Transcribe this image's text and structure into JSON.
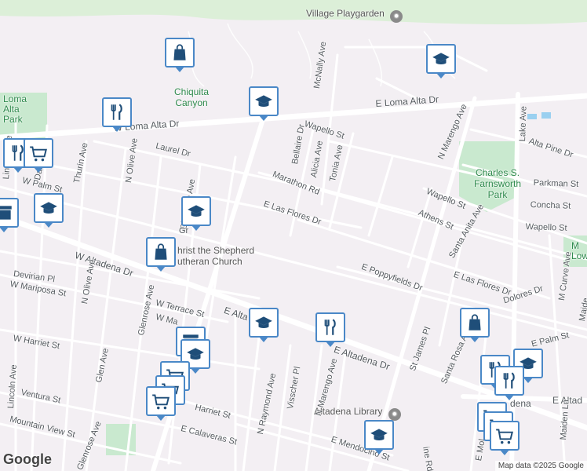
{
  "map": {
    "attribution": "Map data ©2025 Google",
    "logo": "Google",
    "colors": {
      "background": "#f3eff3",
      "park": "#c9e9cf",
      "road": "#ffffff",
      "marker_border": "#4a88c7",
      "marker_icon": "#1f4e79"
    }
  },
  "streets": [
    {
      "id": "e-loma-alta-dr",
      "label": "E Loma Alta Dr"
    },
    {
      "id": "w-loma-alta-dr",
      "label": "W Loma Alta Dr"
    },
    {
      "id": "mcnally-ave",
      "label": "McNally Ave"
    },
    {
      "id": "bellaire-dr",
      "label": "Bellaire Dr"
    },
    {
      "id": "alicia-ave",
      "label": "Alicia Ave"
    },
    {
      "id": "tonia-ave",
      "label": "Tonia Ave"
    },
    {
      "id": "wapello-st-n",
      "label": "Wapello St"
    },
    {
      "id": "n-marengo-ave-n",
      "label": "N Marengo Ave"
    },
    {
      "id": "lake-ave",
      "label": "Lake Ave"
    },
    {
      "id": "alta-pine-dr",
      "label": "Alta Pine Dr"
    },
    {
      "id": "laurel-dr",
      "label": "Laurel Dr"
    },
    {
      "id": "dabney-st",
      "label": "Dabney St"
    },
    {
      "id": "thurin-ave",
      "label": "Thurin Ave"
    },
    {
      "id": "n-olive-ave-n",
      "label": "N Olive Ave"
    },
    {
      "id": "marathon-rd",
      "label": "Marathon Rd"
    },
    {
      "id": "w-palm-st",
      "label": "W Palm St"
    },
    {
      "id": "lincoln-ave-n",
      "label": "Lincoln Ave"
    },
    {
      "id": "parkman-st",
      "label": "Parkman St"
    },
    {
      "id": "wapello-st-e",
      "label": "Wapello St"
    },
    {
      "id": "concha-st",
      "label": "Concha St"
    },
    {
      "id": "athens-st",
      "label": "Athens St"
    },
    {
      "id": "wapello-st-se",
      "label": "Wapello St"
    },
    {
      "id": "e-las-flores-dr",
      "label": "E Las Flores Dr"
    },
    {
      "id": "santa-anita-ave",
      "label": "Santa Anita Ave"
    },
    {
      "id": "glenrose-ave-n",
      "label": "Glenrose Ave"
    },
    {
      "id": "w-altadena-dr",
      "label": "W Altadena Dr"
    },
    {
      "id": "devirian-pl",
      "label": "Devirian Pl"
    },
    {
      "id": "n-olive-ave-s",
      "label": "N Olive Ave"
    },
    {
      "id": "w-mariposa-st",
      "label": "W Mariposa St"
    },
    {
      "id": "w-terrace-st",
      "label": "W Terrace St"
    },
    {
      "id": "glenrose-ave-s",
      "label": "Glenrose Ave"
    },
    {
      "id": "w-ma",
      "label": "W Ma"
    },
    {
      "id": "e-poppyfields-dr",
      "label": "E Poppyfields Dr"
    },
    {
      "id": "e-las-flores-dr-e",
      "label": "E Las Flores Dr"
    },
    {
      "id": "m-curve-ave",
      "label": "M Curve Ave"
    },
    {
      "id": "dolores-dr",
      "label": "Dolores Dr"
    },
    {
      "id": "e-altadena-dr-w",
      "label": "E Alta"
    },
    {
      "id": "e-altadena-dr",
      "label": "E Altadena Dr"
    },
    {
      "id": "w-harriet-st",
      "label": "W Harriet St"
    },
    {
      "id": "glen-ave",
      "label": "Glen Ave"
    },
    {
      "id": "lincoln-ave-s",
      "label": "Lincoln Ave"
    },
    {
      "id": "st-james-pl",
      "label": "St James Pl"
    },
    {
      "id": "santa-rosa-ave",
      "label": "Santa Rosa Ave"
    },
    {
      "id": "e-palm-st",
      "label": "E Palm St"
    },
    {
      "id": "ventura-st",
      "label": "Ventura St"
    },
    {
      "id": "harriet-st",
      "label": "Harriet St"
    },
    {
      "id": "n-raymond-ave",
      "label": "N Raymond Ave"
    },
    {
      "id": "visscher-pl",
      "label": "Visscher Pl"
    },
    {
      "id": "n-marengo-ave-s",
      "label": "N Marengo Ave"
    },
    {
      "id": "e-calaveras-st",
      "label": "E Calaveras St"
    },
    {
      "id": "mountain-view-st",
      "label": "Mountain View St"
    },
    {
      "id": "glenrose-ave-bottom",
      "label": "Glenrose Ave"
    },
    {
      "id": "e-mendocino-st",
      "label": "E Mendocino St"
    },
    {
      "id": "ine-rd",
      "label": "ine Rd"
    },
    {
      "id": "e-altadena-dr-east",
      "label": "E Altad"
    },
    {
      "id": "maiden-ln",
      "label": "Maiden Ln"
    },
    {
      "id": "e-mol",
      "label": "E Mol"
    },
    {
      "id": "maide",
      "label": "Maide"
    },
    {
      "id": "e-gr-alt",
      "label": "Gr"
    },
    {
      "id": "e-alta-dena",
      "label": "dena"
    }
  ],
  "places": {
    "village_playgarden": "Village Playgarden",
    "chiquita_canyon": [
      "Chiquita",
      "Canyon"
    ],
    "loma_alta_park": [
      "Loma",
      "Alta",
      "Park"
    ],
    "charles_farnsworth_park": [
      "Charles S.",
      "Farnsworth",
      "Park"
    ],
    "christ_shepherd": [
      "hrist the Shepherd",
      "utheran Church"
    ],
    "altadena_library": "Altadena Library",
    "m_low": [
      "M",
      "Low"
    ]
  },
  "markers": [
    {
      "id": "shop-top",
      "icon": "shopping-bag"
    },
    {
      "id": "school-top-right",
      "icon": "graduation-cap"
    },
    {
      "id": "school-chiquita",
      "icon": "graduation-cap"
    },
    {
      "id": "restaurant-loma",
      "icon": "restaurant"
    },
    {
      "id": "restaurant-left",
      "icon": "restaurant"
    },
    {
      "id": "grocery-left",
      "icon": "shopping-cart"
    },
    {
      "id": "school-left",
      "icon": "graduation-cap"
    },
    {
      "id": "store-left",
      "icon": "store"
    },
    {
      "id": "school-glenrose",
      "icon": "graduation-cap"
    },
    {
      "id": "shop-church",
      "icon": "shopping-bag"
    },
    {
      "id": "school-altadena",
      "icon": "graduation-cap"
    },
    {
      "id": "restaurant-altadena",
      "icon": "restaurant"
    },
    {
      "id": "shop-santa-rosa",
      "icon": "shopping-bag"
    },
    {
      "id": "store-cluster",
      "icon": "store"
    },
    {
      "id": "school-cluster",
      "icon": "graduation-cap"
    },
    {
      "id": "grocery-cluster-1",
      "icon": "shopping-cart"
    },
    {
      "id": "grocery-cluster-2",
      "icon": "shopping-cart"
    },
    {
      "id": "grocery-cluster-3",
      "icon": "shopping-cart"
    },
    {
      "id": "school-library",
      "icon": "graduation-cap"
    },
    {
      "id": "restaurant-east-1",
      "icon": "restaurant"
    },
    {
      "id": "school-east",
      "icon": "graduation-cap"
    },
    {
      "id": "restaurant-east-2",
      "icon": "restaurant"
    },
    {
      "id": "grocery-east-1",
      "icon": "shopping-cart"
    },
    {
      "id": "grocery-east-2",
      "icon": "shopping-cart"
    },
    {
      "id": "grocery-east-3",
      "icon": "shopping-cart"
    }
  ]
}
